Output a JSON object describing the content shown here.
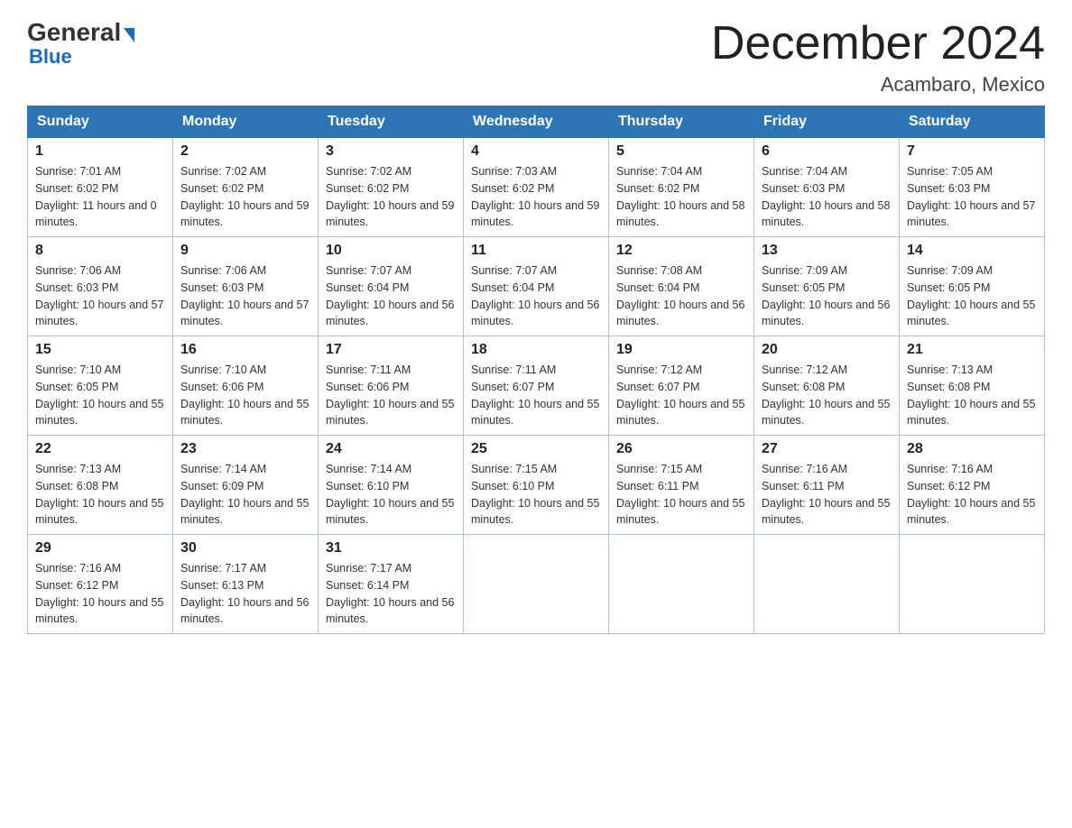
{
  "logo": {
    "general": "General",
    "triangle": "▶",
    "blue": "Blue"
  },
  "header": {
    "title": "December 2024",
    "subtitle": "Acambaro, Mexico"
  },
  "days_of_week": [
    "Sunday",
    "Monday",
    "Tuesday",
    "Wednesday",
    "Thursday",
    "Friday",
    "Saturday"
  ],
  "weeks": [
    [
      {
        "day": "1",
        "sunrise": "7:01 AM",
        "sunset": "6:02 PM",
        "daylight": "11 hours and 0 minutes."
      },
      {
        "day": "2",
        "sunrise": "7:02 AM",
        "sunset": "6:02 PM",
        "daylight": "10 hours and 59 minutes."
      },
      {
        "day": "3",
        "sunrise": "7:02 AM",
        "sunset": "6:02 PM",
        "daylight": "10 hours and 59 minutes."
      },
      {
        "day": "4",
        "sunrise": "7:03 AM",
        "sunset": "6:02 PM",
        "daylight": "10 hours and 59 minutes."
      },
      {
        "day": "5",
        "sunrise": "7:04 AM",
        "sunset": "6:02 PM",
        "daylight": "10 hours and 58 minutes."
      },
      {
        "day": "6",
        "sunrise": "7:04 AM",
        "sunset": "6:03 PM",
        "daylight": "10 hours and 58 minutes."
      },
      {
        "day": "7",
        "sunrise": "7:05 AM",
        "sunset": "6:03 PM",
        "daylight": "10 hours and 57 minutes."
      }
    ],
    [
      {
        "day": "8",
        "sunrise": "7:06 AM",
        "sunset": "6:03 PM",
        "daylight": "10 hours and 57 minutes."
      },
      {
        "day": "9",
        "sunrise": "7:06 AM",
        "sunset": "6:03 PM",
        "daylight": "10 hours and 57 minutes."
      },
      {
        "day": "10",
        "sunrise": "7:07 AM",
        "sunset": "6:04 PM",
        "daylight": "10 hours and 56 minutes."
      },
      {
        "day": "11",
        "sunrise": "7:07 AM",
        "sunset": "6:04 PM",
        "daylight": "10 hours and 56 minutes."
      },
      {
        "day": "12",
        "sunrise": "7:08 AM",
        "sunset": "6:04 PM",
        "daylight": "10 hours and 56 minutes."
      },
      {
        "day": "13",
        "sunrise": "7:09 AM",
        "sunset": "6:05 PM",
        "daylight": "10 hours and 56 minutes."
      },
      {
        "day": "14",
        "sunrise": "7:09 AM",
        "sunset": "6:05 PM",
        "daylight": "10 hours and 55 minutes."
      }
    ],
    [
      {
        "day": "15",
        "sunrise": "7:10 AM",
        "sunset": "6:05 PM",
        "daylight": "10 hours and 55 minutes."
      },
      {
        "day": "16",
        "sunrise": "7:10 AM",
        "sunset": "6:06 PM",
        "daylight": "10 hours and 55 minutes."
      },
      {
        "day": "17",
        "sunrise": "7:11 AM",
        "sunset": "6:06 PM",
        "daylight": "10 hours and 55 minutes."
      },
      {
        "day": "18",
        "sunrise": "7:11 AM",
        "sunset": "6:07 PM",
        "daylight": "10 hours and 55 minutes."
      },
      {
        "day": "19",
        "sunrise": "7:12 AM",
        "sunset": "6:07 PM",
        "daylight": "10 hours and 55 minutes."
      },
      {
        "day": "20",
        "sunrise": "7:12 AM",
        "sunset": "6:08 PM",
        "daylight": "10 hours and 55 minutes."
      },
      {
        "day": "21",
        "sunrise": "7:13 AM",
        "sunset": "6:08 PM",
        "daylight": "10 hours and 55 minutes."
      }
    ],
    [
      {
        "day": "22",
        "sunrise": "7:13 AM",
        "sunset": "6:08 PM",
        "daylight": "10 hours and 55 minutes."
      },
      {
        "day": "23",
        "sunrise": "7:14 AM",
        "sunset": "6:09 PM",
        "daylight": "10 hours and 55 minutes."
      },
      {
        "day": "24",
        "sunrise": "7:14 AM",
        "sunset": "6:10 PM",
        "daylight": "10 hours and 55 minutes."
      },
      {
        "day": "25",
        "sunrise": "7:15 AM",
        "sunset": "6:10 PM",
        "daylight": "10 hours and 55 minutes."
      },
      {
        "day": "26",
        "sunrise": "7:15 AM",
        "sunset": "6:11 PM",
        "daylight": "10 hours and 55 minutes."
      },
      {
        "day": "27",
        "sunrise": "7:16 AM",
        "sunset": "6:11 PM",
        "daylight": "10 hours and 55 minutes."
      },
      {
        "day": "28",
        "sunrise": "7:16 AM",
        "sunset": "6:12 PM",
        "daylight": "10 hours and 55 minutes."
      }
    ],
    [
      {
        "day": "29",
        "sunrise": "7:16 AM",
        "sunset": "6:12 PM",
        "daylight": "10 hours and 55 minutes."
      },
      {
        "day": "30",
        "sunrise": "7:17 AM",
        "sunset": "6:13 PM",
        "daylight": "10 hours and 56 minutes."
      },
      {
        "day": "31",
        "sunrise": "7:17 AM",
        "sunset": "6:14 PM",
        "daylight": "10 hours and 56 minutes."
      },
      null,
      null,
      null,
      null
    ]
  ]
}
